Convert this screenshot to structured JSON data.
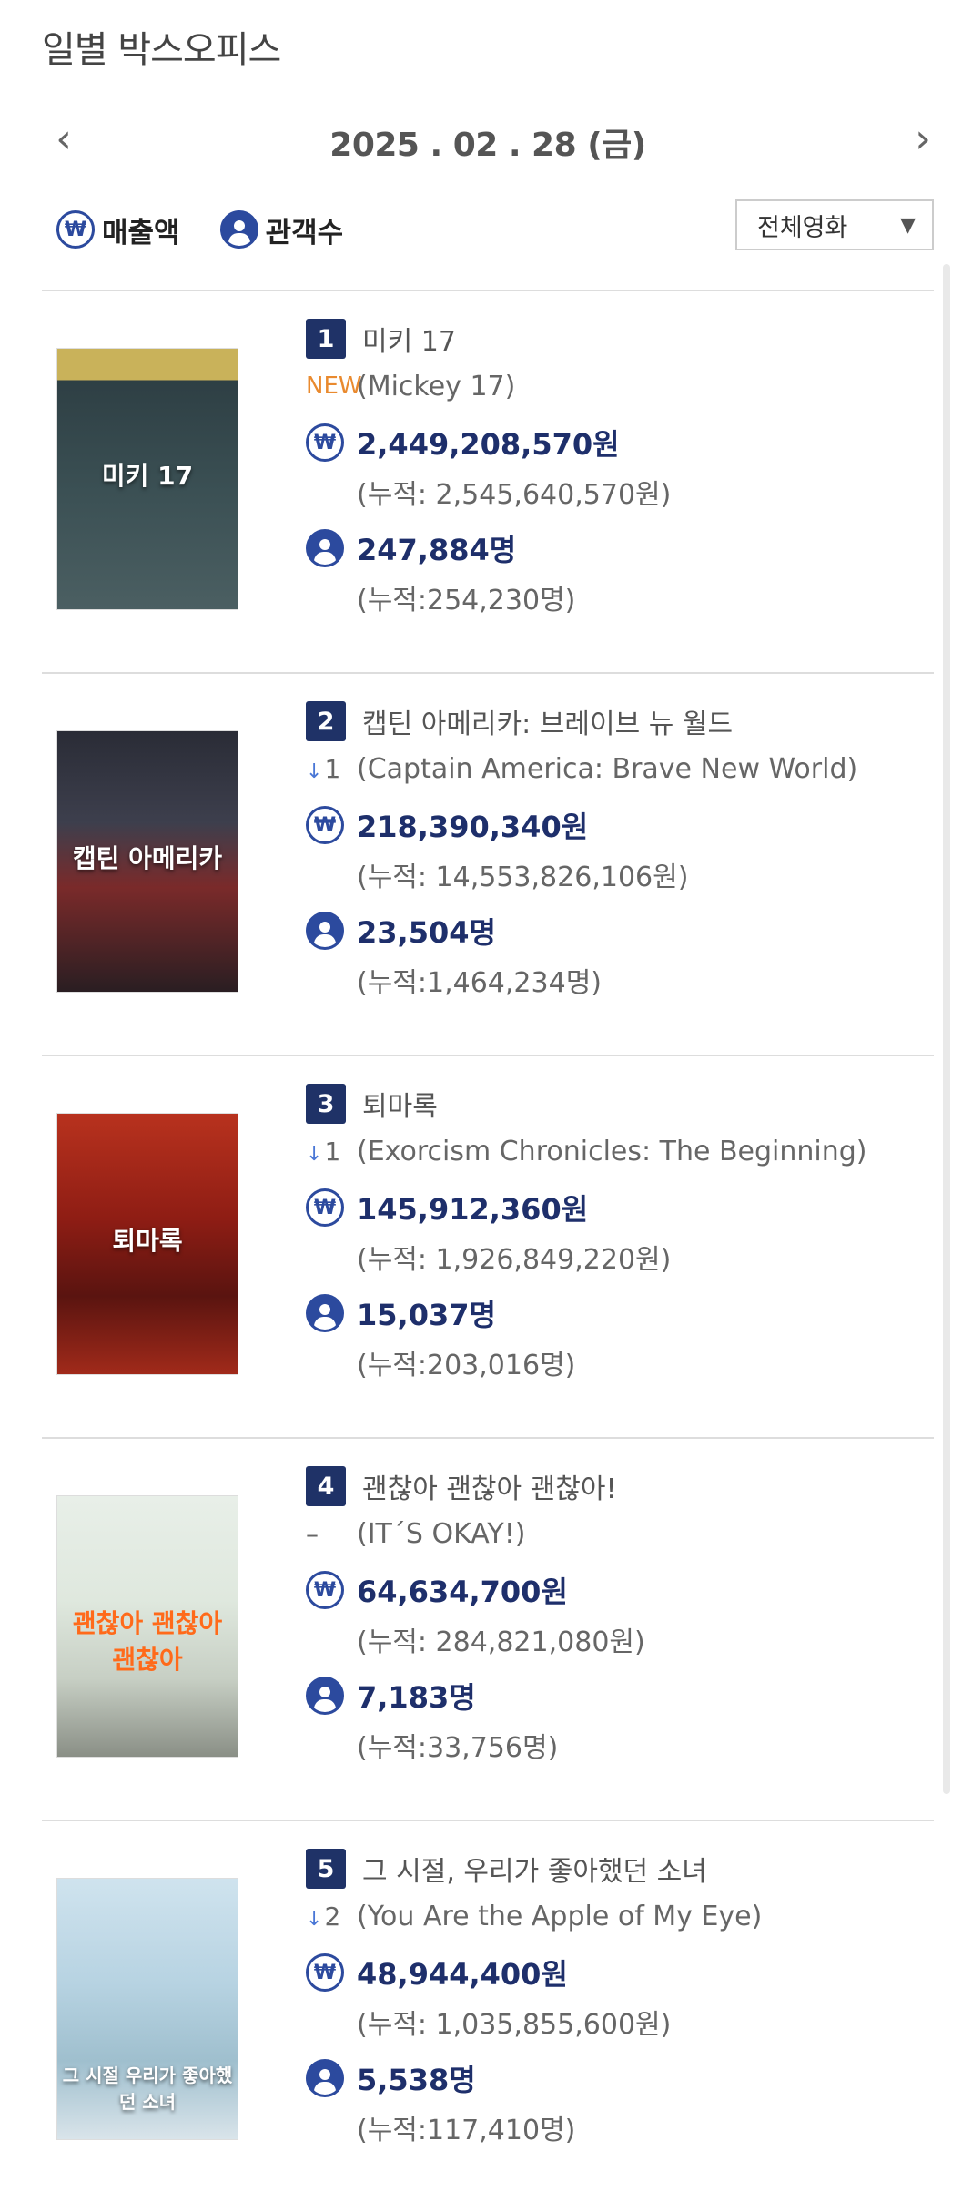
{
  "page": {
    "title": "일별 박스오피스"
  },
  "date_nav": {
    "date": "2025 . 02 . 28  (금)",
    "prev": "‹",
    "next": "›"
  },
  "toggles": {
    "sales_icon": "₩",
    "sales_label": "매출액",
    "audience_label": "관객수"
  },
  "filter": {
    "selected": "전체영화",
    "caret": "▼"
  },
  "colors": {
    "accent": "#1f3267",
    "icon": "#2c4a9e",
    "new": "#e98a2f",
    "down": "#4a77d6"
  },
  "movies": [
    {
      "rank": "1",
      "title_ko": "미키 17",
      "change": "NEW",
      "title_en": "(Mickey 17)",
      "sales": "2,449,208,570원",
      "sales_cum": "(누적: 2,545,640,570원)",
      "audience": "247,884명",
      "audience_cum": "(누적:254,230명)",
      "poster_text": "미키 17"
    },
    {
      "rank": "2",
      "title_ko": "캡틴 아메리카: 브레이브 뉴 월드",
      "change": "1",
      "title_en": "(Captain America: Brave New World)",
      "sales": "218,390,340원",
      "sales_cum": "(누적: 14,553,826,106원)",
      "audience": "23,504명",
      "audience_cum": "(누적:1,464,234명)",
      "poster_text": "캡틴 아메리카"
    },
    {
      "rank": "3",
      "title_ko": "퇴마록",
      "change": "1",
      "title_en": "(Exorcism Chronicles: The Beginning)",
      "sales": "145,912,360원",
      "sales_cum": "(누적: 1,926,849,220원)",
      "audience": "15,037명",
      "audience_cum": "(누적:203,016명)",
      "poster_text": "퇴마록"
    },
    {
      "rank": "4",
      "title_ko": "괜찮아 괜찮아 괜찮아!",
      "change": "–",
      "title_en": "(IT´S OKAY!)",
      "sales": "64,634,700원",
      "sales_cum": "(누적: 284,821,080원)",
      "audience": "7,183명",
      "audience_cum": "(누적:33,756명)",
      "poster_text": "괜찮아 괜찮아 괜찮아"
    },
    {
      "rank": "5",
      "title_ko": "그 시절, 우리가 좋아했던 소녀",
      "change": "2",
      "title_en": "(You Are the Apple of My Eye)",
      "sales": "48,944,400원",
      "sales_cum": "(누적: 1,035,855,600원)",
      "audience": "5,538명",
      "audience_cum": "(누적:117,410명)",
      "poster_text": "그 시절 우리가 좋아했던 소녀"
    }
  ]
}
